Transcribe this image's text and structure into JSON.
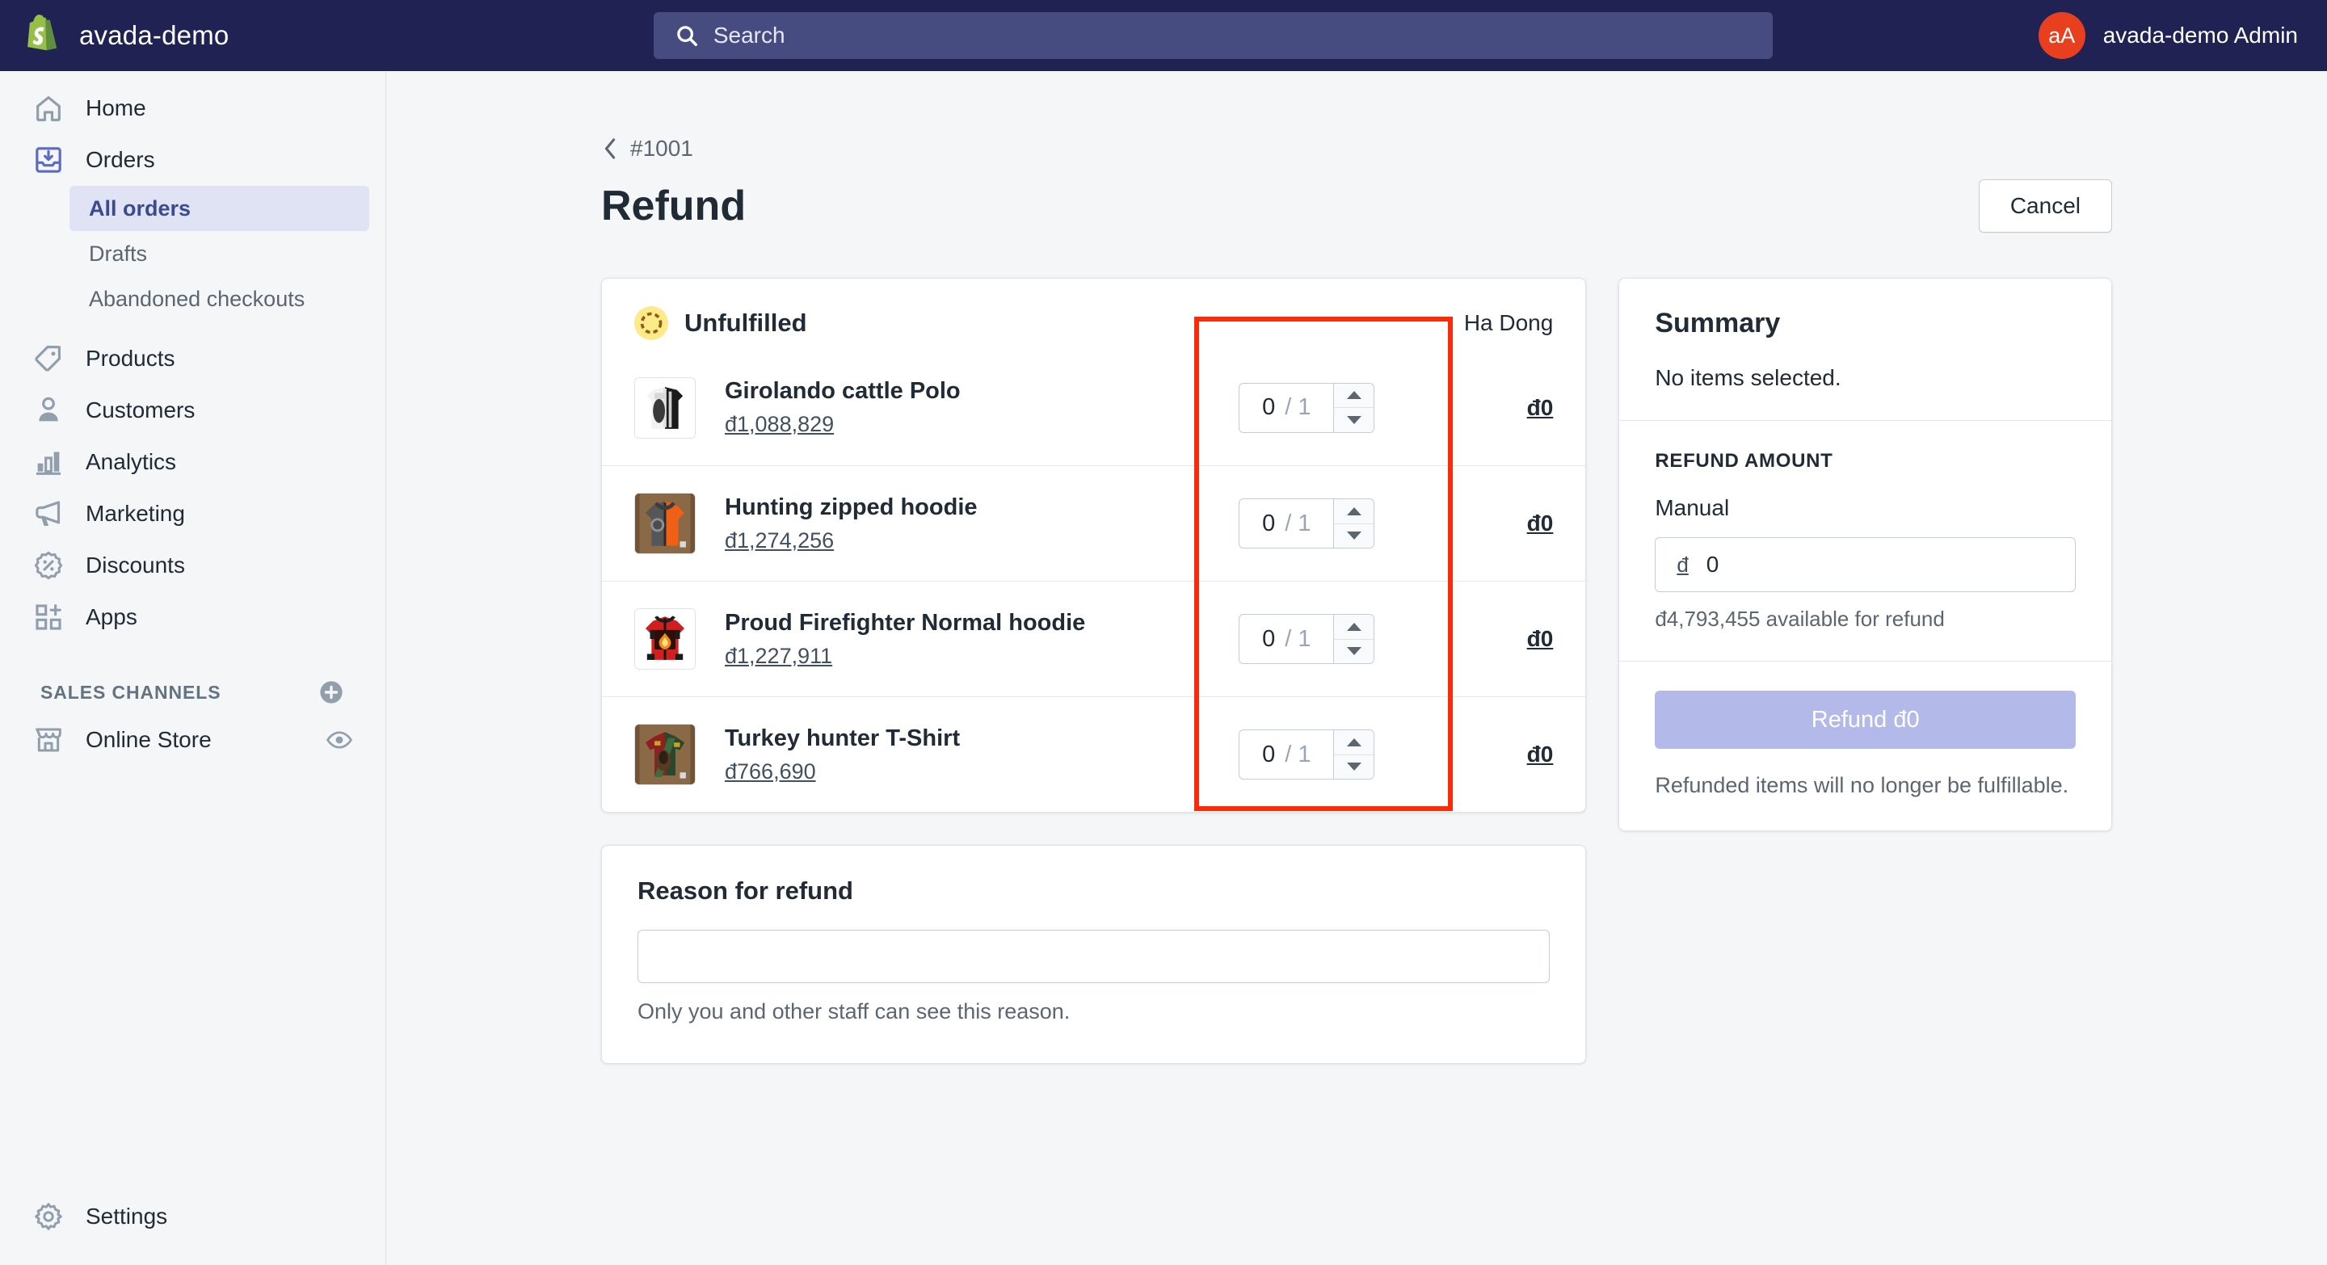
{
  "topbar": {
    "brand_name": "avada-demo",
    "search_placeholder": "Search",
    "avatar_initials": "aA",
    "user_name": "avada-demo Admin",
    "bg_color": "#1f2252",
    "avatar_color": "#e8401f"
  },
  "sidebar": {
    "items": [
      {
        "label": "Home",
        "icon": "home-icon"
      },
      {
        "label": "Orders",
        "icon": "orders-inbox-icon"
      },
      {
        "label": "Products",
        "icon": "tag-icon"
      },
      {
        "label": "Customers",
        "icon": "person-icon"
      },
      {
        "label": "Analytics",
        "icon": "bar-chart-icon"
      },
      {
        "label": "Marketing",
        "icon": "megaphone-icon"
      },
      {
        "label": "Discounts",
        "icon": "percent-badge-icon"
      },
      {
        "label": "Apps",
        "icon": "apps-grid-icon"
      }
    ],
    "order_subitems": [
      {
        "label": "All orders",
        "selected": true
      },
      {
        "label": "Drafts",
        "selected": false
      },
      {
        "label": "Abandoned checkouts",
        "selected": false
      }
    ],
    "sales_channels": {
      "title": "SALES CHANNELS",
      "add_icon": "plus-circle-icon",
      "items": [
        {
          "label": "Online Store",
          "icon": "storefront-icon",
          "trailing_icon": "eye-icon"
        }
      ]
    },
    "settings": {
      "label": "Settings",
      "icon": "gear-icon"
    },
    "active_color": "#dfe3f3",
    "active_text_color": "#3c4a8e"
  },
  "page": {
    "breadcrumb": "#1001",
    "back_icon": "chevron-left-icon",
    "title": "Refund",
    "cancel_label": "Cancel"
  },
  "fulfillment_card": {
    "status": "Unfulfilled",
    "status_icon": "dotted-circle-icon",
    "status_color": "#ffea8a",
    "location": "Ha Dong",
    "items": [
      {
        "name": "Girolando cattle Polo",
        "price": "đ1,088,829",
        "qty_value": "0",
        "qty_max": "/ 1",
        "amount": "đ0",
        "thumb": "polo-shirt-black-white"
      },
      {
        "name": "Hunting zipped hoodie",
        "price": "đ1,274,256",
        "qty_value": "0",
        "qty_max": "/ 1",
        "amount": "đ0",
        "thumb": "hoodie-orange-gray"
      },
      {
        "name": "Proud Firefighter Normal hoodie",
        "price": "đ1,227,911",
        "qty_value": "0",
        "qty_max": "/ 1",
        "amount": "đ0",
        "thumb": "jacket-red-fire"
      },
      {
        "name": "Turkey hunter T-Shirt",
        "price": "đ766,690",
        "qty_value": "0",
        "qty_max": "/ 1",
        "amount": "đ0",
        "thumb": "tshirt-red-green"
      }
    ]
  },
  "reason_card": {
    "title": "Reason for refund",
    "input_value": "",
    "input_placeholder": "",
    "help_text": "Only you and other staff can see this reason."
  },
  "summary_card": {
    "title": "Summary",
    "no_items_note": "No items selected.",
    "refund_amount_caption": "REFUND AMOUNT",
    "manual_label": "Manual",
    "manual_symbol": "đ",
    "manual_value": "0",
    "available_note": "đ4,793,455 available for refund",
    "refund_button_label": "Refund đ0",
    "refund_button_color": "#b3b9e8",
    "footer_note": "Refunded items will no longer be fulfillable."
  },
  "annotation": {
    "color": "#fb2a09",
    "label": "quantity-steppers-highlight"
  }
}
